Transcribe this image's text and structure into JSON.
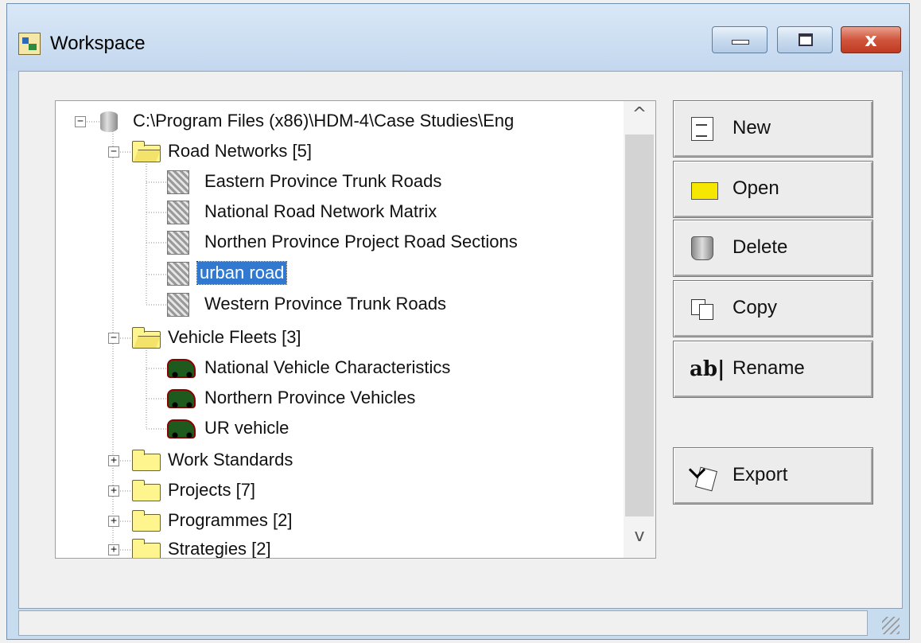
{
  "window": {
    "title": "Workspace"
  },
  "tree": {
    "root": "C:\\Program Files (x86)\\HDM-4\\Case Studies\\Eng",
    "road_networks": {
      "label": "Road Networks [5]",
      "items": [
        "Eastern Province Trunk Roads",
        "National Road Network Matrix",
        "Northen Province Project Road Sections",
        "urban road",
        "Western Province Trunk Roads"
      ],
      "selected": "urban road"
    },
    "vehicle_fleets": {
      "label": "Vehicle Fleets [3]",
      "items": [
        "National Vehicle Characteristics",
        "Northern Province Vehicles",
        "UR vehicle"
      ]
    },
    "work_standards": "Work Standards",
    "projects": "Projects [7]",
    "programmes": "Programmes [2]",
    "strategies": "Strategies [2]",
    "expand_glyph": "+",
    "collapse_glyph": "−"
  },
  "buttons": {
    "new": "New",
    "open": "Open",
    "delete": "Delete",
    "copy": "Copy",
    "rename": "Rename",
    "rename_glyph": "ab|",
    "export": "Export"
  },
  "scrollbar": {
    "up": "^",
    "down": "v"
  },
  "titlebar_buttons": {
    "close": "x"
  }
}
